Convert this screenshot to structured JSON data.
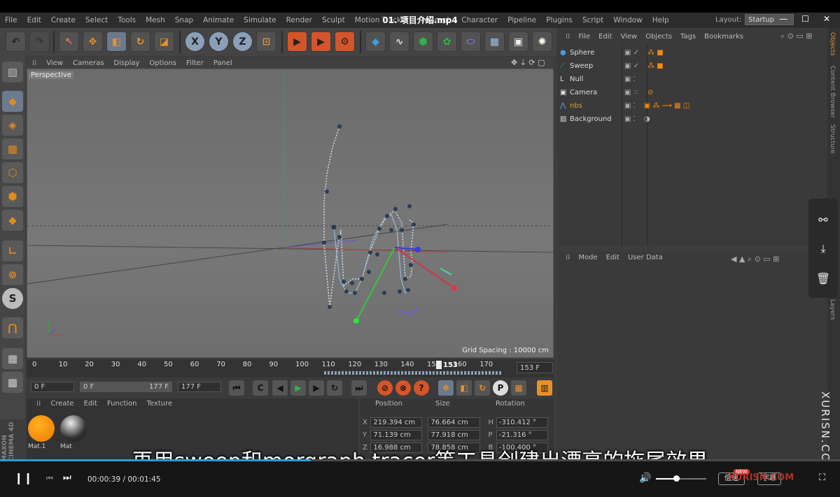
{
  "video": {
    "title": "01. 项目介绍.mp4"
  },
  "window": {
    "layout_label": "Layout:",
    "layout_value": "Startup",
    "minimize": "—",
    "maximize": "☐",
    "close": "✕"
  },
  "menu": [
    "File",
    "Edit",
    "Create",
    "Select",
    "Tools",
    "Mesh",
    "Snap",
    "Animate",
    "Simulate",
    "Render",
    "Sculpt",
    "Motion Tracker",
    "MoGraph",
    "Character",
    "Pipeline",
    "Plugins",
    "Script",
    "Window",
    "Help"
  ],
  "viewport": {
    "menu": [
      "View",
      "Cameras",
      "Display",
      "Options",
      "Filter",
      "Panel"
    ],
    "label": "Perspective",
    "grid_spacing": "Grid Spacing : 10000 cm"
  },
  "toolbar": {
    "axis_x": "X",
    "axis_y": "Y",
    "axis_z": "Z"
  },
  "timeline": {
    "ticks": [
      "0",
      "10",
      "20",
      "30",
      "40",
      "50",
      "60",
      "70",
      "80",
      "90",
      "100",
      "110",
      "120",
      "130",
      "140",
      "150",
      "160",
      "170"
    ],
    "current_frame": "153",
    "frame_field": "153 F"
  },
  "transport": {
    "start": "0 F",
    "range_start": "0 F",
    "range_end": "177 F",
    "end": "177 F"
  },
  "materials": {
    "menu": [
      "Create",
      "Edit",
      "Function",
      "Texture"
    ],
    "items": [
      {
        "name": "Mat.1"
      },
      {
        "name": "Mat"
      }
    ]
  },
  "coordinates": {
    "headers": [
      "Position",
      "Size",
      "Rotation"
    ],
    "rows": [
      {
        "axis": "X",
        "pos": "219.394 cm",
        "size": "76.664 cm",
        "rlabel": "H",
        "rot": "-310.412 °"
      },
      {
        "axis": "Y",
        "pos": "71.139 cm",
        "size": "77.918 cm",
        "rlabel": "P",
        "rot": "-21.316 °"
      },
      {
        "axis": "Z",
        "pos": "16.988 cm",
        "size": "78.858 cm",
        "rlabel": "B",
        "rot": "-100.400 °"
      }
    ]
  },
  "objects": {
    "menu": [
      "File",
      "Edit",
      "View",
      "Objects",
      "Tags",
      "Bookmarks"
    ],
    "items": [
      {
        "name": "Sphere"
      },
      {
        "name": "Sweep"
      },
      {
        "name": "Null"
      },
      {
        "name": "Camera"
      },
      {
        "name": "nbs"
      },
      {
        "name": "Background"
      }
    ]
  },
  "attributes": {
    "menu": [
      "Mode",
      "Edit",
      "User Data"
    ]
  },
  "side_tabs": [
    "Objects",
    "Content Browser",
    "Structure",
    "Layers"
  ],
  "subtitle": "再用sweep和morgraph tracer等工具创建出漂亮的拖尾效果",
  "player": {
    "time": "00:00:39 / 00:01:45",
    "progress": 0.37,
    "volume": 0.4,
    "speed_label": "倍速",
    "new_badge": "NEW",
    "subtitle_label": "字幕"
  },
  "watermark": {
    "side": "XURISN.COM",
    "bottom": "XURISN.COM"
  },
  "brand": "MAXON CINEMA 4D"
}
